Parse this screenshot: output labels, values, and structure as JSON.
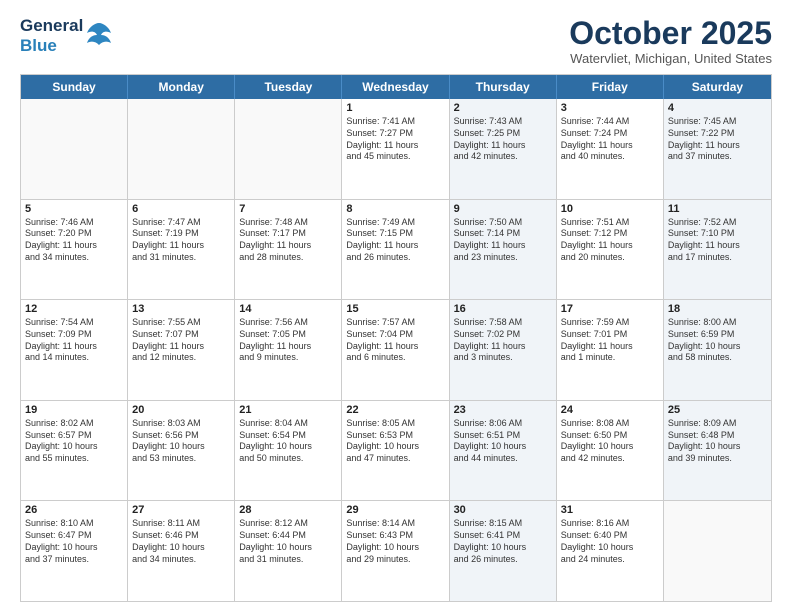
{
  "header": {
    "logo_line1": "General",
    "logo_line2": "Blue",
    "month_title": "October 2025",
    "location": "Watervliet, Michigan, United States"
  },
  "days_of_week": [
    "Sunday",
    "Monday",
    "Tuesday",
    "Wednesday",
    "Thursday",
    "Friday",
    "Saturday"
  ],
  "weeks": [
    [
      {
        "day": "",
        "info": [],
        "shaded": false,
        "empty": true
      },
      {
        "day": "",
        "info": [],
        "shaded": false,
        "empty": true
      },
      {
        "day": "",
        "info": [],
        "shaded": false,
        "empty": true
      },
      {
        "day": "1",
        "info": [
          "Sunrise: 7:41 AM",
          "Sunset: 7:27 PM",
          "Daylight: 11 hours",
          "and 45 minutes."
        ],
        "shaded": false,
        "empty": false
      },
      {
        "day": "2",
        "info": [
          "Sunrise: 7:43 AM",
          "Sunset: 7:25 PM",
          "Daylight: 11 hours",
          "and 42 minutes."
        ],
        "shaded": true,
        "empty": false
      },
      {
        "day": "3",
        "info": [
          "Sunrise: 7:44 AM",
          "Sunset: 7:24 PM",
          "Daylight: 11 hours",
          "and 40 minutes."
        ],
        "shaded": false,
        "empty": false
      },
      {
        "day": "4",
        "info": [
          "Sunrise: 7:45 AM",
          "Sunset: 7:22 PM",
          "Daylight: 11 hours",
          "and 37 minutes."
        ],
        "shaded": true,
        "empty": false
      }
    ],
    [
      {
        "day": "5",
        "info": [
          "Sunrise: 7:46 AM",
          "Sunset: 7:20 PM",
          "Daylight: 11 hours",
          "and 34 minutes."
        ],
        "shaded": false,
        "empty": false
      },
      {
        "day": "6",
        "info": [
          "Sunrise: 7:47 AM",
          "Sunset: 7:19 PM",
          "Daylight: 11 hours",
          "and 31 minutes."
        ],
        "shaded": false,
        "empty": false
      },
      {
        "day": "7",
        "info": [
          "Sunrise: 7:48 AM",
          "Sunset: 7:17 PM",
          "Daylight: 11 hours",
          "and 28 minutes."
        ],
        "shaded": false,
        "empty": false
      },
      {
        "day": "8",
        "info": [
          "Sunrise: 7:49 AM",
          "Sunset: 7:15 PM",
          "Daylight: 11 hours",
          "and 26 minutes."
        ],
        "shaded": false,
        "empty": false
      },
      {
        "day": "9",
        "info": [
          "Sunrise: 7:50 AM",
          "Sunset: 7:14 PM",
          "Daylight: 11 hours",
          "and 23 minutes."
        ],
        "shaded": true,
        "empty": false
      },
      {
        "day": "10",
        "info": [
          "Sunrise: 7:51 AM",
          "Sunset: 7:12 PM",
          "Daylight: 11 hours",
          "and 20 minutes."
        ],
        "shaded": false,
        "empty": false
      },
      {
        "day": "11",
        "info": [
          "Sunrise: 7:52 AM",
          "Sunset: 7:10 PM",
          "Daylight: 11 hours",
          "and 17 minutes."
        ],
        "shaded": true,
        "empty": false
      }
    ],
    [
      {
        "day": "12",
        "info": [
          "Sunrise: 7:54 AM",
          "Sunset: 7:09 PM",
          "Daylight: 11 hours",
          "and 14 minutes."
        ],
        "shaded": false,
        "empty": false
      },
      {
        "day": "13",
        "info": [
          "Sunrise: 7:55 AM",
          "Sunset: 7:07 PM",
          "Daylight: 11 hours",
          "and 12 minutes."
        ],
        "shaded": false,
        "empty": false
      },
      {
        "day": "14",
        "info": [
          "Sunrise: 7:56 AM",
          "Sunset: 7:05 PM",
          "Daylight: 11 hours",
          "and 9 minutes."
        ],
        "shaded": false,
        "empty": false
      },
      {
        "day": "15",
        "info": [
          "Sunrise: 7:57 AM",
          "Sunset: 7:04 PM",
          "Daylight: 11 hours",
          "and 6 minutes."
        ],
        "shaded": false,
        "empty": false
      },
      {
        "day": "16",
        "info": [
          "Sunrise: 7:58 AM",
          "Sunset: 7:02 PM",
          "Daylight: 11 hours",
          "and 3 minutes."
        ],
        "shaded": true,
        "empty": false
      },
      {
        "day": "17",
        "info": [
          "Sunrise: 7:59 AM",
          "Sunset: 7:01 PM",
          "Daylight: 11 hours",
          "and 1 minute."
        ],
        "shaded": false,
        "empty": false
      },
      {
        "day": "18",
        "info": [
          "Sunrise: 8:00 AM",
          "Sunset: 6:59 PM",
          "Daylight: 10 hours",
          "and 58 minutes."
        ],
        "shaded": true,
        "empty": false
      }
    ],
    [
      {
        "day": "19",
        "info": [
          "Sunrise: 8:02 AM",
          "Sunset: 6:57 PM",
          "Daylight: 10 hours",
          "and 55 minutes."
        ],
        "shaded": false,
        "empty": false
      },
      {
        "day": "20",
        "info": [
          "Sunrise: 8:03 AM",
          "Sunset: 6:56 PM",
          "Daylight: 10 hours",
          "and 53 minutes."
        ],
        "shaded": false,
        "empty": false
      },
      {
        "day": "21",
        "info": [
          "Sunrise: 8:04 AM",
          "Sunset: 6:54 PM",
          "Daylight: 10 hours",
          "and 50 minutes."
        ],
        "shaded": false,
        "empty": false
      },
      {
        "day": "22",
        "info": [
          "Sunrise: 8:05 AM",
          "Sunset: 6:53 PM",
          "Daylight: 10 hours",
          "and 47 minutes."
        ],
        "shaded": false,
        "empty": false
      },
      {
        "day": "23",
        "info": [
          "Sunrise: 8:06 AM",
          "Sunset: 6:51 PM",
          "Daylight: 10 hours",
          "and 44 minutes."
        ],
        "shaded": true,
        "empty": false
      },
      {
        "day": "24",
        "info": [
          "Sunrise: 8:08 AM",
          "Sunset: 6:50 PM",
          "Daylight: 10 hours",
          "and 42 minutes."
        ],
        "shaded": false,
        "empty": false
      },
      {
        "day": "25",
        "info": [
          "Sunrise: 8:09 AM",
          "Sunset: 6:48 PM",
          "Daylight: 10 hours",
          "and 39 minutes."
        ],
        "shaded": true,
        "empty": false
      }
    ],
    [
      {
        "day": "26",
        "info": [
          "Sunrise: 8:10 AM",
          "Sunset: 6:47 PM",
          "Daylight: 10 hours",
          "and 37 minutes."
        ],
        "shaded": false,
        "empty": false
      },
      {
        "day": "27",
        "info": [
          "Sunrise: 8:11 AM",
          "Sunset: 6:46 PM",
          "Daylight: 10 hours",
          "and 34 minutes."
        ],
        "shaded": false,
        "empty": false
      },
      {
        "day": "28",
        "info": [
          "Sunrise: 8:12 AM",
          "Sunset: 6:44 PM",
          "Daylight: 10 hours",
          "and 31 minutes."
        ],
        "shaded": false,
        "empty": false
      },
      {
        "day": "29",
        "info": [
          "Sunrise: 8:14 AM",
          "Sunset: 6:43 PM",
          "Daylight: 10 hours",
          "and 29 minutes."
        ],
        "shaded": false,
        "empty": false
      },
      {
        "day": "30",
        "info": [
          "Sunrise: 8:15 AM",
          "Sunset: 6:41 PM",
          "Daylight: 10 hours",
          "and 26 minutes."
        ],
        "shaded": true,
        "empty": false
      },
      {
        "day": "31",
        "info": [
          "Sunrise: 8:16 AM",
          "Sunset: 6:40 PM",
          "Daylight: 10 hours",
          "and 24 minutes."
        ],
        "shaded": false,
        "empty": false
      },
      {
        "day": "",
        "info": [],
        "shaded": true,
        "empty": true
      }
    ]
  ]
}
